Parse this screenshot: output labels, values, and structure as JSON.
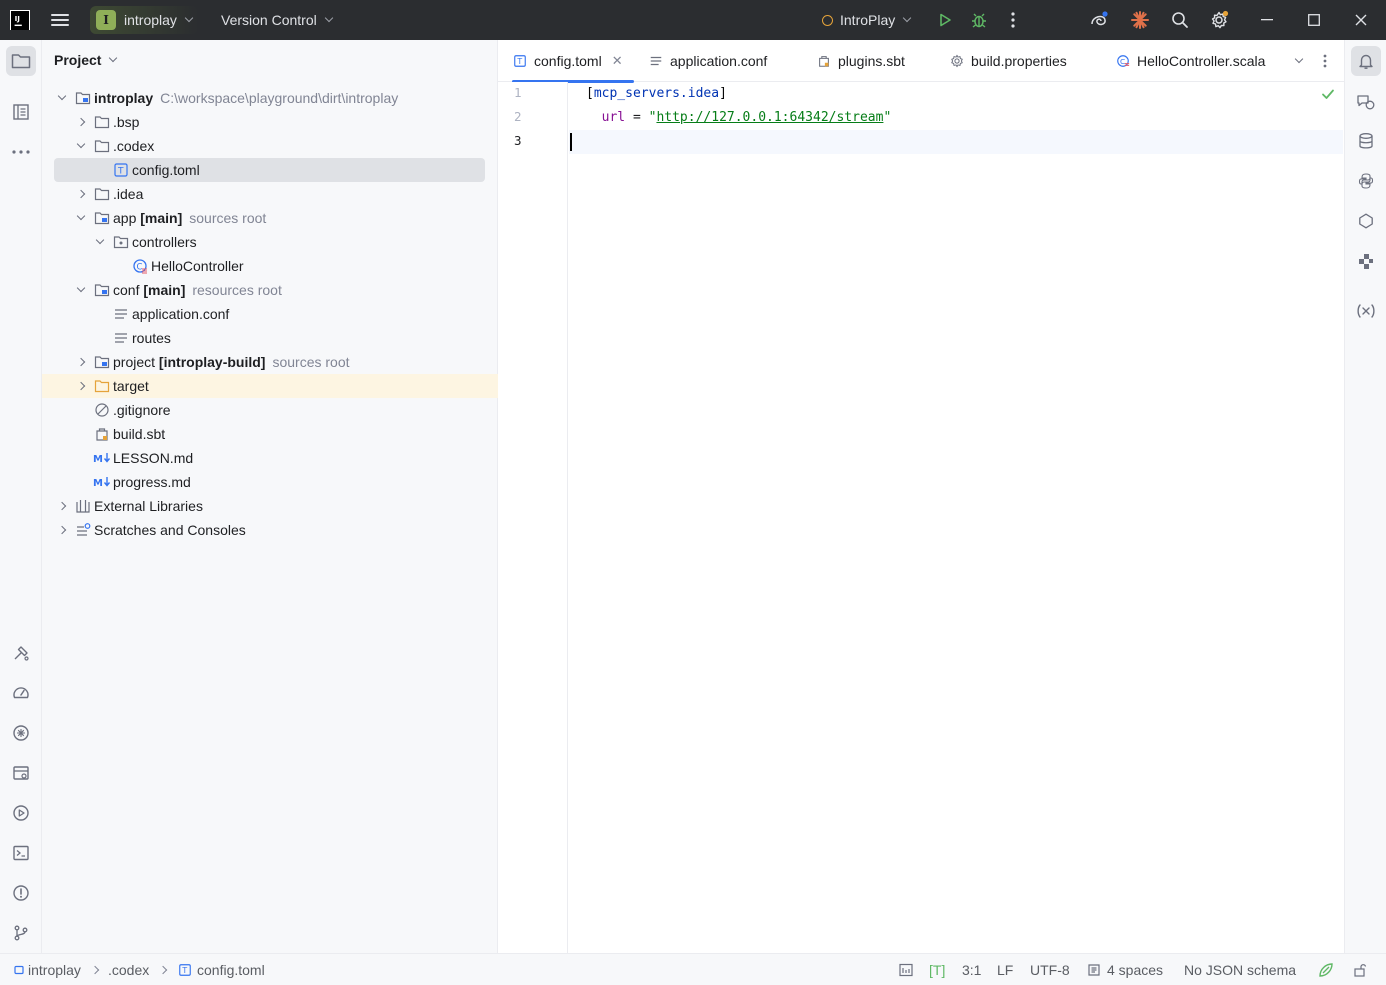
{
  "titlebar": {
    "project_badge": "I",
    "project_name": "introplay",
    "vcs_label": "Version Control",
    "run_config": "IntroPlay"
  },
  "project_panel": {
    "title": "Project",
    "tree": [
      {
        "label": "introplay",
        "hint": "C:\\workspace\\playground\\dirt\\introplay"
      },
      {
        "label": ".bsp"
      },
      {
        "label": ".codex"
      },
      {
        "label": "config.toml"
      },
      {
        "label": ".idea"
      },
      {
        "label": "app",
        "tag": "[main]",
        "hint": "sources root"
      },
      {
        "label": "controllers"
      },
      {
        "label": "HelloController"
      },
      {
        "label": "conf",
        "tag": "[main]",
        "hint": "resources root"
      },
      {
        "label": "application.conf"
      },
      {
        "label": "routes"
      },
      {
        "label": "project",
        "tag": "[introplay-build]",
        "hint": "sources root"
      },
      {
        "label": "target"
      },
      {
        "label": ".gitignore"
      },
      {
        "label": "build.sbt"
      },
      {
        "label": "LESSON.md"
      },
      {
        "label": "progress.md"
      },
      {
        "label": "External Libraries"
      },
      {
        "label": "Scratches and Consoles"
      }
    ]
  },
  "editor": {
    "tabs": [
      {
        "label": "config.toml",
        "close": "✕"
      },
      {
        "label": "application.conf"
      },
      {
        "label": "plugins.sbt"
      },
      {
        "label": "build.properties"
      },
      {
        "label": "HelloController.scala"
      }
    ],
    "line_numbers": [
      "1",
      "2",
      "3"
    ],
    "code": {
      "l1_open": "[",
      "l1_table": "mcp_servers.idea",
      "l1_close": "]",
      "l2_indent": "  ",
      "l2_key": "url",
      "l2_eq": " = ",
      "l2_q1": "\"",
      "l2_url": "http://127.0.0.1:64342/stream",
      "l2_q2": "\""
    },
    "file_icon_letter": "T"
  },
  "statusbar": {
    "breadcrumb": [
      "introplay",
      ".codex",
      "config.toml"
    ],
    "file_type": "[T]",
    "position": "3:1",
    "line_sep": "LF",
    "encoding": "UTF-8",
    "indent": "4 spaces",
    "schema": "No JSON schema"
  },
  "colors": {
    "accent": "#3574f0",
    "titlebar_bg": "#2b2d30",
    "selection_bg": "#dfe1e5",
    "excluded_highlight": "#fdf5e2",
    "string_green": "#067d17",
    "run_green": "#5fb865"
  }
}
